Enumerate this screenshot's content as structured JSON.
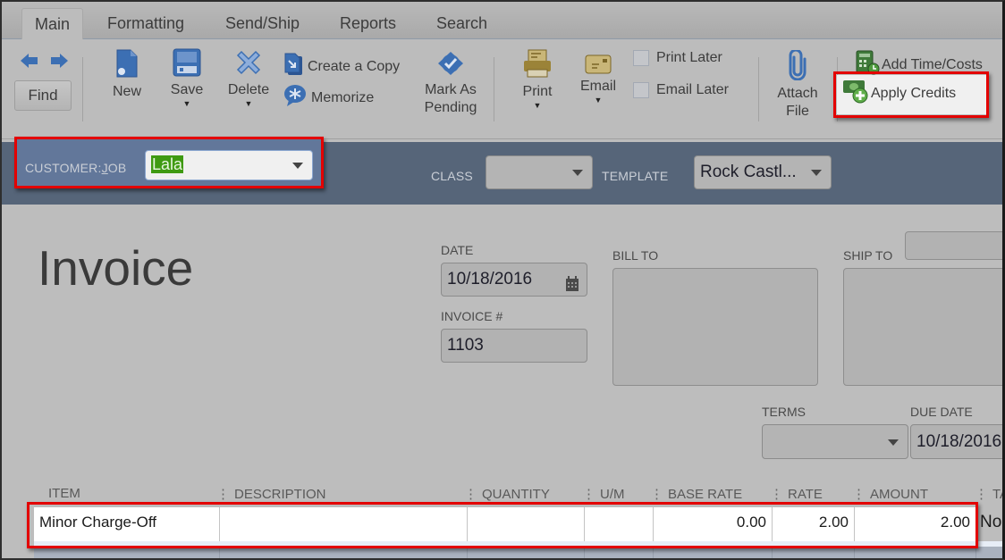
{
  "tabs": [
    {
      "label": "Main",
      "active": true
    },
    {
      "label": "Formatting",
      "active": false
    },
    {
      "label": "Send/Ship",
      "active": false
    },
    {
      "label": "Reports",
      "active": false
    },
    {
      "label": "Search",
      "active": false
    }
  ],
  "toolbar": {
    "find": "Find",
    "new": "New",
    "save": "Save",
    "delete": "Delete",
    "create_copy": "Create a Copy",
    "memorize": "Memorize",
    "mark_as_pending_1": "Mark As",
    "mark_as_pending_2": "Pending",
    "print": "Print",
    "email": "Email",
    "print_later": "Print Later",
    "email_later": "Email Later",
    "attach_1": "Attach",
    "attach_2": "File",
    "add_time_costs": "Add Time/Costs",
    "apply_credits": "Apply Credits"
  },
  "header_bar": {
    "customer_job_label_pre": "CUSTOMER:",
    "customer_job_label_u": "J",
    "customer_job_label_post": "OB",
    "customer_job_value": "Lala",
    "class_label": "CLASS",
    "class_value": "",
    "template_label": "TEMPLATE",
    "template_value": "Rock Castl..."
  },
  "form": {
    "title": "Invoice",
    "date_label": "DATE",
    "date_value": "10/18/2016",
    "invoice_no_label": "INVOICE #",
    "invoice_no_value": "1103",
    "bill_to_label": "BILL TO",
    "ship_to_label": "SHIP TO",
    "terms_label": "TERMS",
    "terms_value": "",
    "due_date_label": "DUE DATE",
    "due_date_value": "10/18/2016"
  },
  "table": {
    "columns": [
      "ITEM",
      "DESCRIPTION",
      "QUANTITY",
      "U/M",
      "BASE RATE",
      "RATE",
      "AMOUNT",
      "TA"
    ],
    "rows": [
      {
        "item": "Minor Charge-Off",
        "description": "",
        "quantity": "",
        "um": "",
        "base_rate": "0.00",
        "rate": "2.00",
        "amount": "2.00",
        "tax": "No"
      }
    ]
  },
  "colors": {
    "highlight": "#e30000",
    "header_bar": "#566579",
    "selection": "#3f9a12",
    "icon_blue": "#3c6fb3",
    "icon_gold": "#9b8338",
    "icon_green": "#4d9a3c"
  }
}
